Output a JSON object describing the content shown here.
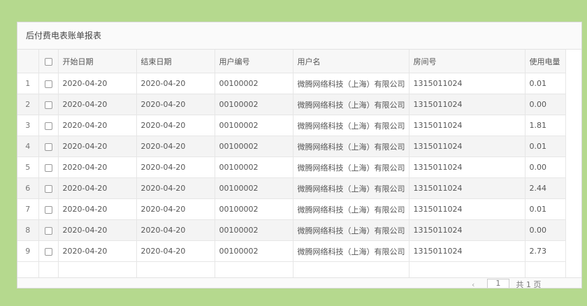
{
  "panel": {
    "title": "后付费电表账单报表"
  },
  "table": {
    "columns": [
      "开始日期",
      "结束日期",
      "用户编号",
      "用户名",
      "房间号",
      "使用电量"
    ],
    "rows": [
      {
        "no": "1",
        "start": "2020-04-20",
        "end": "2020-04-20",
        "user_id": "00100002",
        "user_name": "微腾网络科技（上海）有限公司",
        "room": "1315011024",
        "usage": "0.01"
      },
      {
        "no": "2",
        "start": "2020-04-20",
        "end": "2020-04-20",
        "user_id": "00100002",
        "user_name": "微腾网络科技（上海）有限公司",
        "room": "1315011024",
        "usage": "0.00"
      },
      {
        "no": "3",
        "start": "2020-04-20",
        "end": "2020-04-20",
        "user_id": "00100002",
        "user_name": "微腾网络科技（上海）有限公司",
        "room": "1315011024",
        "usage": "1.81"
      },
      {
        "no": "4",
        "start": "2020-04-20",
        "end": "2020-04-20",
        "user_id": "00100002",
        "user_name": "微腾网络科技（上海）有限公司",
        "room": "1315011024",
        "usage": "0.01"
      },
      {
        "no": "5",
        "start": "2020-04-20",
        "end": "2020-04-20",
        "user_id": "00100002",
        "user_name": "微腾网络科技（上海）有限公司",
        "room": "1315011024",
        "usage": "0.00"
      },
      {
        "no": "6",
        "start": "2020-04-20",
        "end": "2020-04-20",
        "user_id": "00100002",
        "user_name": "微腾网络科技（上海）有限公司",
        "room": "1315011024",
        "usage": "2.44"
      },
      {
        "no": "7",
        "start": "2020-04-20",
        "end": "2020-04-20",
        "user_id": "00100002",
        "user_name": "微腾网络科技（上海）有限公司",
        "room": "1315011024",
        "usage": "0.01"
      },
      {
        "no": "8",
        "start": "2020-04-20",
        "end": "2020-04-20",
        "user_id": "00100002",
        "user_name": "微腾网络科技（上海）有限公司",
        "room": "1315011024",
        "usage": "0.00"
      },
      {
        "no": "9",
        "start": "2020-04-20",
        "end": "2020-04-20",
        "user_id": "00100002",
        "user_name": "微腾网络科技（上海）有限公司",
        "room": "1315011024",
        "usage": "2.73"
      }
    ]
  },
  "pager": {
    "prev_icon": "chevron-left-icon",
    "current_page": "1",
    "total_label": "共 1 页"
  },
  "colors": {
    "frame": "#b5d98e",
    "alt_row": "#f4f4f4"
  }
}
